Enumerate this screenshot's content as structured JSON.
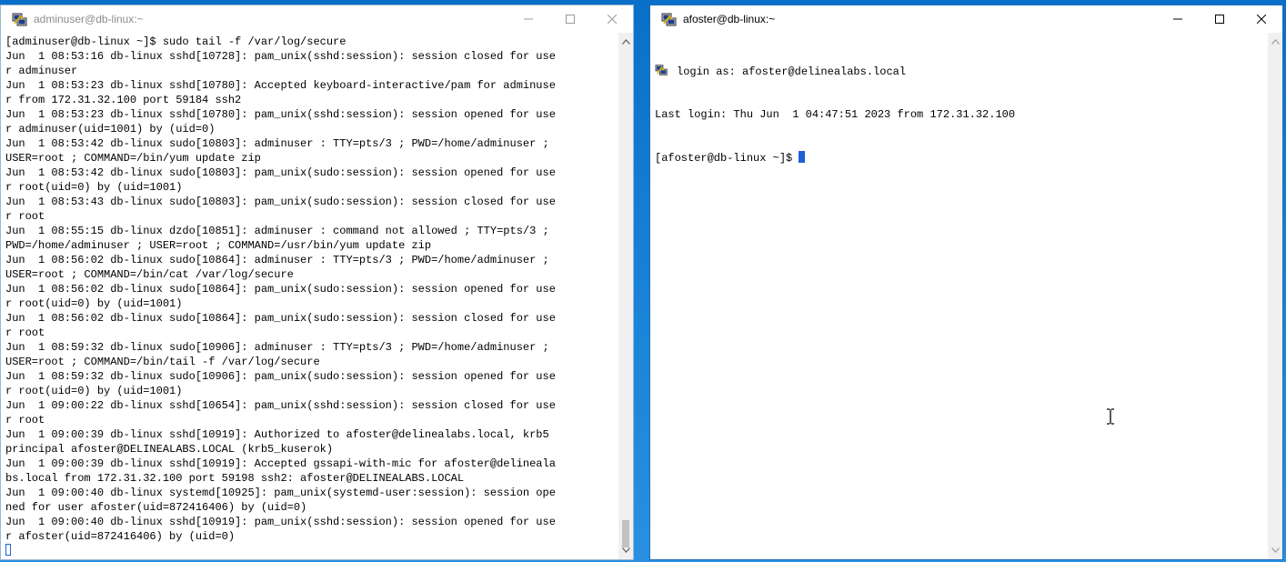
{
  "left_window": {
    "title": "adminuser@db-linux:~",
    "lines": [
      "[adminuser@db-linux ~]$ sudo tail -f /var/log/secure",
      "Jun  1 08:53:16 db-linux sshd[10728]: pam_unix(sshd:session): session closed for use",
      "r adminuser",
      "Jun  1 08:53:23 db-linux sshd[10780]: Accepted keyboard-interactive/pam for adminuse",
      "r from 172.31.32.100 port 59184 ssh2",
      "Jun  1 08:53:23 db-linux sshd[10780]: pam_unix(sshd:session): session opened for use",
      "r adminuser(uid=1001) by (uid=0)",
      "Jun  1 08:53:42 db-linux sudo[10803]: adminuser : TTY=pts/3 ; PWD=/home/adminuser ;",
      "USER=root ; COMMAND=/bin/yum update zip",
      "Jun  1 08:53:42 db-linux sudo[10803]: pam_unix(sudo:session): session opened for use",
      "r root(uid=0) by (uid=1001)",
      "Jun  1 08:53:43 db-linux sudo[10803]: pam_unix(sudo:session): session closed for use",
      "r root",
      "Jun  1 08:55:15 db-linux dzdo[10851]: adminuser : command not allowed ; TTY=pts/3 ;",
      "PWD=/home/adminuser ; USER=root ; COMMAND=/usr/bin/yum update zip",
      "Jun  1 08:56:02 db-linux sudo[10864]: adminuser : TTY=pts/3 ; PWD=/home/adminuser ;",
      "USER=root ; COMMAND=/bin/cat /var/log/secure",
      "Jun  1 08:56:02 db-linux sudo[10864]: pam_unix(sudo:session): session opened for use",
      "r root(uid=0) by (uid=1001)",
      "Jun  1 08:56:02 db-linux sudo[10864]: pam_unix(sudo:session): session closed for use",
      "r root",
      "Jun  1 08:59:32 db-linux sudo[10906]: adminuser : TTY=pts/3 ; PWD=/home/adminuser ;",
      "USER=root ; COMMAND=/bin/tail -f /var/log/secure",
      "Jun  1 08:59:32 db-linux sudo[10906]: pam_unix(sudo:session): session opened for use",
      "r root(uid=0) by (uid=1001)",
      "Jun  1 09:00:22 db-linux sshd[10654]: pam_unix(sshd:session): session closed for use",
      "r root",
      "Jun  1 09:00:39 db-linux sshd[10919]: Authorized to afoster@delinealabs.local, krb5",
      "principal afoster@DELINEALABS.LOCAL (krb5_kuserok)",
      "Jun  1 09:00:39 db-linux sshd[10919]: Accepted gssapi-with-mic for afoster@delineala",
      "bs.local from 172.31.32.100 port 59198 ssh2: afoster@DELINEALABS.LOCAL",
      "Jun  1 09:00:40 db-linux systemd[10925]: pam_unix(systemd-user:session): session ope",
      "ned for user afoster(uid=872416406) by (uid=0)",
      "Jun  1 09:00:40 db-linux sshd[10919]: pam_unix(sshd:session): session opened for use",
      "r afoster(uid=872416406) by (uid=0)"
    ]
  },
  "right_window": {
    "title": "afoster@db-linux:~",
    "login_line": "login as: afoster@delinealabs.local",
    "last_login": "Last login: Thu Jun  1 04:47:51 2023 from 172.31.32.100",
    "prompt": "[afoster@db-linux ~]$ "
  },
  "icons": {
    "app": "putty-icon",
    "minimize": "minimize-icon",
    "maximize": "maximize-icon",
    "close": "close-icon",
    "scroll_up": "chevron-up-icon",
    "scroll_down": "chevron-down-icon",
    "text_cursor": "ibeam-cursor-icon"
  },
  "colors": {
    "cursor": "#1c63d6",
    "window_border_active": "#1e6fb8",
    "desktop": "#1a7fd1"
  }
}
